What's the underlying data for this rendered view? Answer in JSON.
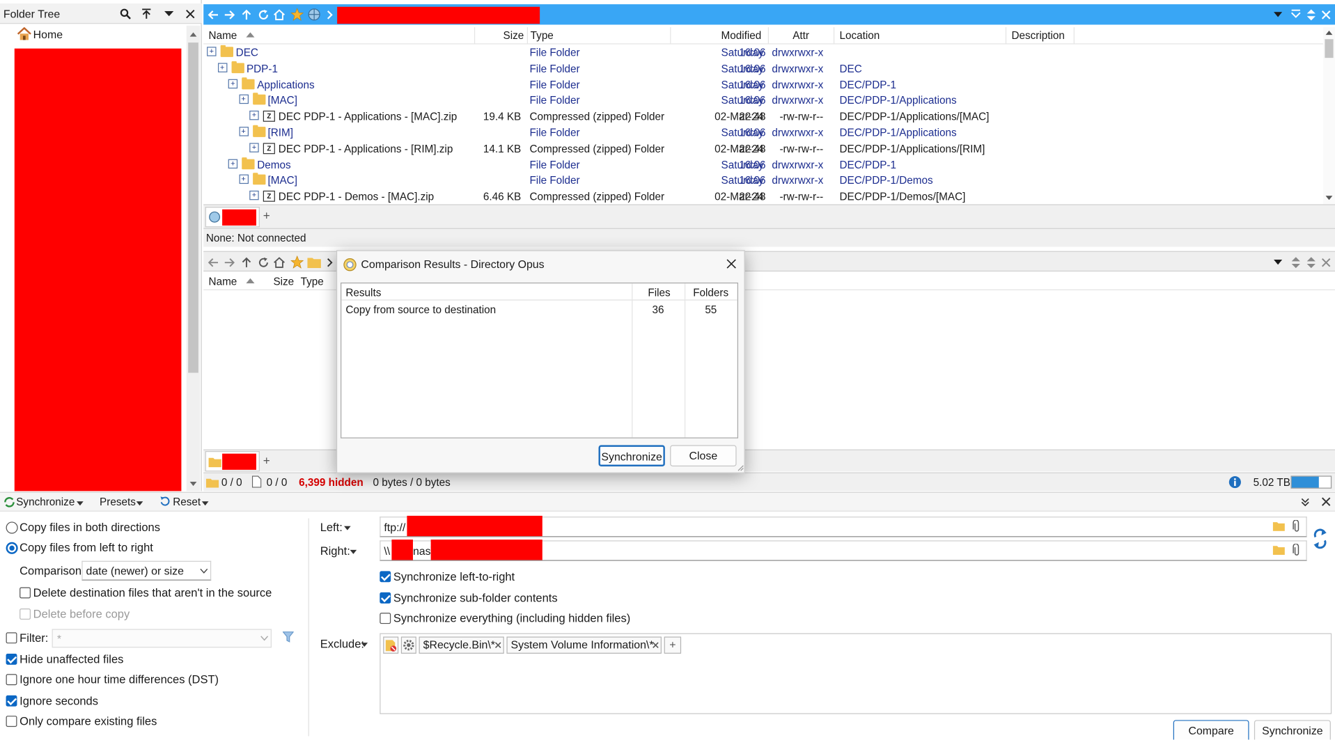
{
  "folder_tree": {
    "title": "Folder Tree",
    "home_label": "Home"
  },
  "upper_lister": {
    "columns": [
      "Name",
      "Size",
      "Type",
      "Modified",
      "Attr",
      "Location",
      "Description"
    ],
    "rows": [
      {
        "name": "DEC",
        "size": "",
        "type": "File Folder",
        "day": "Saturday",
        "time": "16:06",
        "attr": "drwxrwxr-x",
        "location": ""
      },
      {
        "name": "PDP-1",
        "size": "",
        "type": "File Folder",
        "day": "Saturday",
        "time": "16:06",
        "attr": "drwxrwxr-x",
        "location": "DEC"
      },
      {
        "name": "Applications",
        "size": "",
        "type": "File Folder",
        "day": "Saturday",
        "time": "16:06",
        "attr": "drwxrwxr-x",
        "location": "DEC/PDP-1"
      },
      {
        "name": "[MAC]",
        "size": "",
        "type": "File Folder",
        "day": "Saturday",
        "time": "16:06",
        "attr": "drwxrwxr-x",
        "location": "DEC/PDP-1/Applications"
      },
      {
        "name": "DEC PDP-1 - Applications - [MAC].zip",
        "size": "19.4 KB",
        "type": "Compressed (zipped) Folder",
        "day": "02-Mar-24",
        "time": "22:48",
        "attr": "-rw-rw-r--",
        "location": "DEC/PDP-1/Applications/[MAC]"
      },
      {
        "name": "[RIM]",
        "size": "",
        "type": "File Folder",
        "day": "Saturday",
        "time": "16:06",
        "attr": "drwxrwxr-x",
        "location": "DEC/PDP-1/Applications"
      },
      {
        "name": "DEC PDP-1 - Applications - [RIM].zip",
        "size": "14.1 KB",
        "type": "Compressed (zipped) Folder",
        "day": "02-Mar-24",
        "time": "22:48",
        "attr": "-rw-rw-r--",
        "location": "DEC/PDP-1/Applications/[RIM]"
      },
      {
        "name": "Demos",
        "size": "",
        "type": "File Folder",
        "day": "Saturday",
        "time": "16:06",
        "attr": "drwxrwxr-x",
        "location": "DEC/PDP-1"
      },
      {
        "name": "[MAC]",
        "size": "",
        "type": "File Folder",
        "day": "Saturday",
        "time": "16:06",
        "attr": "drwxrwxr-x",
        "location": "DEC/PDP-1/Demos"
      },
      {
        "name": "DEC PDP-1 - Demos - [MAC].zip",
        "size": "6.46 KB",
        "type": "Compressed (zipped) Folder",
        "day": "02-Mar-24",
        "time": "22:48",
        "attr": "-rw-rw-r--",
        "location": "DEC/PDP-1/Demos/[MAC]"
      }
    ],
    "tab_add": "+",
    "status": "None: Not connected"
  },
  "lower_lister": {
    "columns": [
      "Name",
      "Size",
      "Type"
    ],
    "tab_add": "+",
    "status": {
      "folders": "0 / 0",
      "files": "0 / 0",
      "hidden": "6,399 hidden",
      "bytes": "0 bytes / 0 bytes",
      "free": "5.02 TB",
      "free_fraction": 0.7
    }
  },
  "dialog": {
    "title": "Comparison Results - Directory Opus",
    "columns": [
      "Results",
      "Files",
      "Folders"
    ],
    "row": {
      "label": "Copy from source to destination",
      "files": "36",
      "folders": "55"
    },
    "synchronize_label": "Synchronize",
    "close_label": "Close"
  },
  "sync_panel": {
    "toolbar": {
      "synchronize": "Synchronize",
      "presets": "Presets",
      "reset": "Reset"
    },
    "options": {
      "both_directions": "Copy files in both directions",
      "left_to_right": "Copy files from left to right",
      "comparison_label": "Comparison:",
      "comparison_value": "date (newer) or size",
      "delete_dest": "Delete destination files that aren't in the source",
      "delete_before": "Delete before copy",
      "filter_label": "Filter:",
      "filter_value": "*",
      "hide_unaffected": "Hide unaffected files",
      "ignore_dst": "Ignore one hour time differences (DST)",
      "ignore_seconds": "Ignore seconds",
      "only_existing": "Only compare existing files"
    },
    "left_label": "Left:",
    "left_value": "ftp://",
    "right_label": "Right:",
    "right_prefix": "\\\\",
    "right_mid": "nas\\",
    "checks": {
      "sync_ltr": "Synchronize left-to-right",
      "sync_sub": "Synchronize sub-folder contents",
      "sync_all": "Synchronize everything (including hidden files)"
    },
    "exclude_label": "Exclude:",
    "exclude_tags": [
      "$Recycle.Bin\\*",
      "System Volume Information\\*"
    ],
    "exclude_add": "+",
    "compare_button": "Compare",
    "synchronize_button": "Synchronize"
  },
  "colors": {
    "accent": "#39a6f5",
    "hidden_red": "#d40000",
    "link_blue": "#1c2d8f"
  }
}
